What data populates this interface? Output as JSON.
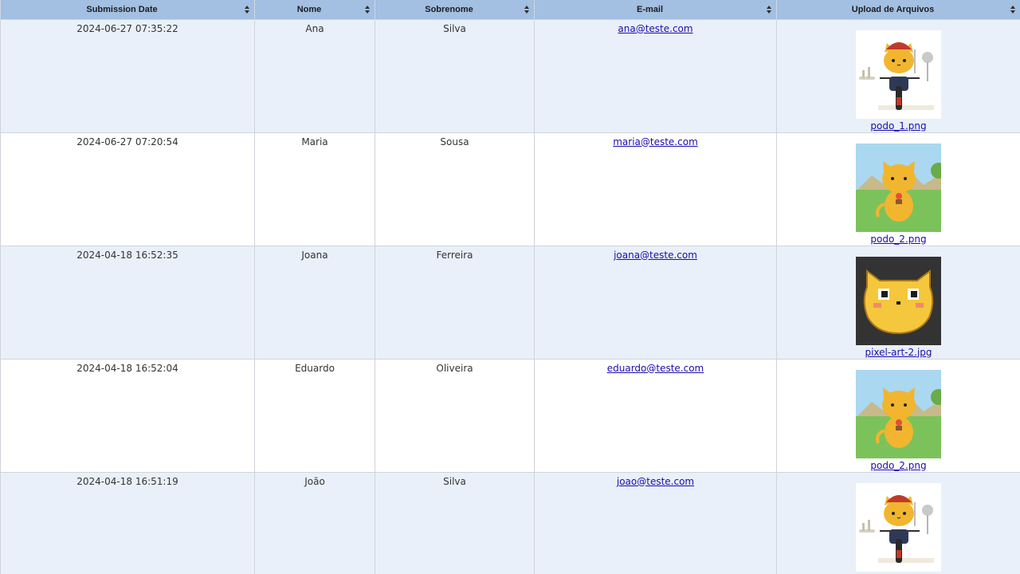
{
  "columns": [
    {
      "label": "Submission Date"
    },
    {
      "label": "Nome"
    },
    {
      "label": "Sobrenome"
    },
    {
      "label": "E-mail"
    },
    {
      "label": "Upload de Arquivos"
    }
  ],
  "rows": [
    {
      "date": "2024-06-27 07:35:22",
      "nome": "Ana",
      "sobrenome": "Silva",
      "email": "ana@teste.com",
      "file": "podo_1.png",
      "image": "cat-on-bicycle"
    },
    {
      "date": "2024-06-27 07:20:54",
      "nome": "Maria",
      "sobrenome": "Sousa",
      "email": "maria@teste.com",
      "file": "podo_2.png",
      "image": "cat-holding-flower-in-meadow"
    },
    {
      "date": "2024-04-18 16:52:35",
      "nome": "Joana",
      "sobrenome": "Ferreira",
      "email": "joana@teste.com",
      "file": "pixel-art-2.jpg",
      "image": "pixel-art-cat-face"
    },
    {
      "date": "2024-04-18 16:52:04",
      "nome": "Eduardo",
      "sobrenome": "Oliveira",
      "email": "eduardo@teste.com",
      "file": "podo_2.png",
      "image": "cat-holding-flower-in-meadow"
    },
    {
      "date": "2024-04-18 16:51:19",
      "nome": "João",
      "sobrenome": "Silva",
      "email": "joao@teste.com",
      "file": "",
      "image": "cat-on-bicycle"
    }
  ],
  "colors": {
    "header_bg": "#a3bfe2",
    "row_alt_bg": "#e9f0f9",
    "link": "#1a0dab"
  }
}
